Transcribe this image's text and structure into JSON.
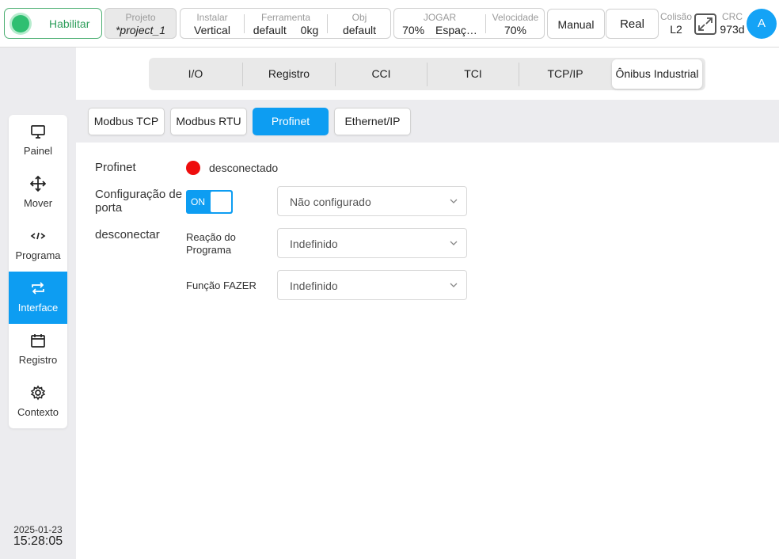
{
  "topbar": {
    "enable_label": "Habilitar",
    "project": {
      "title": "Projeto",
      "value": "*project_1"
    },
    "install": {
      "title": "Instalar",
      "value": "Vertical"
    },
    "tool": {
      "title": "Ferramenta",
      "value": "default",
      "load": "0kg"
    },
    "obj": {
      "title": "Obj",
      "value": "default"
    },
    "jog": {
      "title": "JOGAR",
      "percent": "70%",
      "space": "Espaç…"
    },
    "speed": {
      "title": "Velocidade",
      "value": "70%"
    },
    "mode_button": "Manual",
    "real_button": "Real",
    "collision": {
      "title": "Colisão",
      "value": "L2"
    },
    "crc": {
      "title": "CRC",
      "value": "973d"
    },
    "avatar_letter": "A"
  },
  "sidebar": {
    "items": [
      {
        "label": "Painel",
        "icon": "monitor-icon"
      },
      {
        "label": "Mover",
        "icon": "move-arrows-icon"
      },
      {
        "label": "Programa",
        "icon": "code-icon"
      },
      {
        "label": "Interface",
        "icon": "swap-arrows-icon",
        "active": true
      },
      {
        "label": "Registro",
        "icon": "calendar-icon"
      },
      {
        "label": "Contexto",
        "icon": "gear-icon"
      }
    ],
    "date": "2025-01-23",
    "time": "15:28:05"
  },
  "tabs": [
    "I/O",
    "Registro",
    "CCI",
    "TCI",
    "TCP/IP",
    "Ônibus Industrial"
  ],
  "active_tab": "Ônibus Industrial",
  "subtabs": [
    "Modbus TCP",
    "Modbus RTU",
    "Profinet",
    "Ethernet/IP"
  ],
  "active_subtab": "Profinet",
  "profinet": {
    "label": "Profinet",
    "status": "desconectado",
    "port_config_label_1": "Configuração de",
    "port_config_label_2": "porta",
    "toggle_text": "ON",
    "port_select": "Não configurado",
    "disconnect_label": "desconectar",
    "program_reaction_label_1": "Reação do",
    "program_reaction_label_2": "Programa",
    "program_reaction_select": "Indefinido",
    "do_function_label": "Função FAZER",
    "do_function_select": "Indefinido"
  },
  "colors": {
    "accent": "#0d9df2",
    "enable_green": "#2fbf71",
    "status_red": "#ee0d0d"
  }
}
